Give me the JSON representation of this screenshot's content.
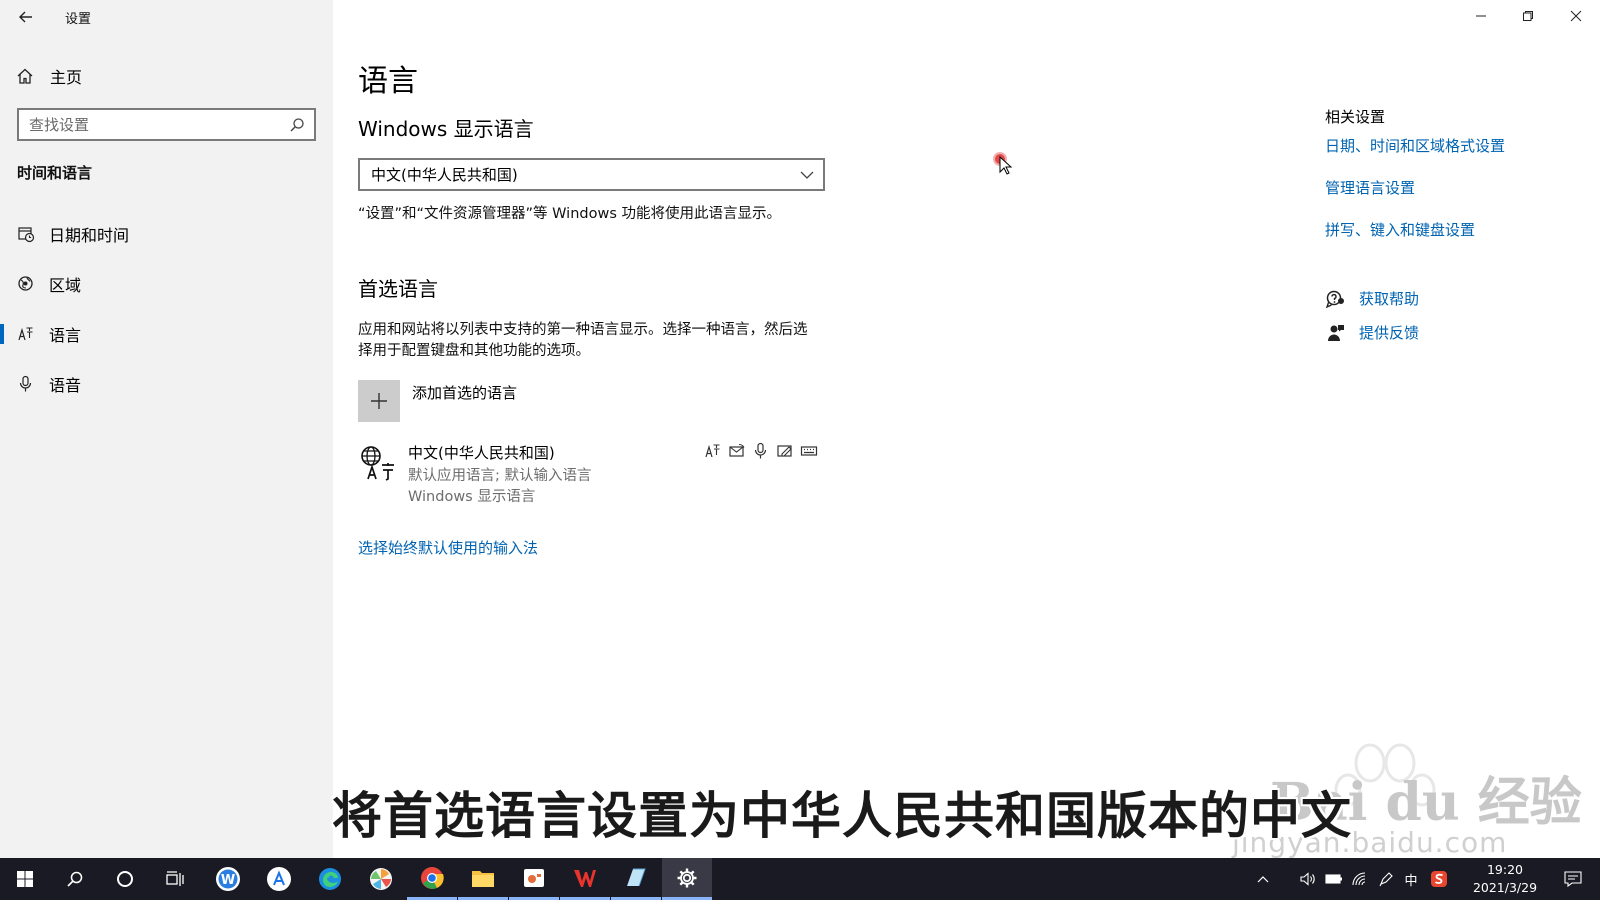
{
  "window": {
    "title": "设置",
    "controls": [
      "minimize",
      "restore",
      "close"
    ]
  },
  "sidebar": {
    "home_label": "主页",
    "search_placeholder": "查找设置",
    "section_heading": "时间和语言",
    "items": [
      {
        "label": "日期和时间",
        "icon": "calendar-clock-icon",
        "active": false
      },
      {
        "label": "区域",
        "icon": "globe-icon",
        "active": false
      },
      {
        "label": "语言",
        "icon": "language-icon",
        "active": true
      },
      {
        "label": "语音",
        "icon": "microphone-icon",
        "active": false
      }
    ]
  },
  "main": {
    "title": "语言",
    "display_language": {
      "heading": "Windows 显示语言",
      "selected": "中文(中华人民共和国)",
      "note": "“设置”和“文件资源管理器”等 Windows 功能将使用此语言显示。"
    },
    "preferred": {
      "heading": "首选语言",
      "description": "应用和网站将以列表中支持的第一种语言显示。选择一种语言，然后选择用于配置键盘和其他功能的选项。",
      "add_label": "添加首选的语言",
      "languages": [
        {
          "name": "中文(中华人民共和国)",
          "sub1": "默认应用语言; 默认输入语言",
          "sub2": "Windows 显示语言",
          "features": [
            "language-pack-icon",
            "text-to-speech-icon",
            "speech-icon",
            "handwriting-icon",
            "keyboard-icon"
          ]
        }
      ]
    },
    "ime_link": "选择始终默认使用的输入法"
  },
  "related": {
    "title": "相关设置",
    "links": [
      "日期、时间和区域格式设置",
      "管理语言设置",
      "拼写、键入和键盘设置"
    ],
    "get_help": "获取帮助",
    "feedback": "提供反馈"
  },
  "caption": "将首选语言设置为中华人民共和国版本的中文",
  "watermark": {
    "brand": "Bai du 经验",
    "url": "jingyan.baidu.com"
  },
  "taskbar": {
    "apps": [
      "start",
      "search",
      "cortana",
      "task-view",
      "app-w",
      "app-a",
      "edge",
      "app-pinwheel",
      "chrome",
      "file-explorer",
      "app-media",
      "wps",
      "app-notepad",
      "settings"
    ],
    "tray": {
      "ime_indicator": "中",
      "time": "19:20",
      "date": "2021/3/29"
    }
  }
}
